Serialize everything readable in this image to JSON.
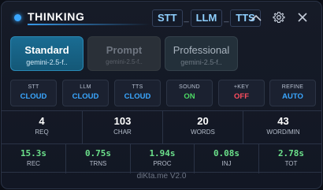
{
  "header": {
    "title": "THINKING",
    "pipeline": [
      "STT",
      "LLM",
      "TTS"
    ],
    "pipeline_separator": "_"
  },
  "modes": [
    {
      "name": "Standard",
      "model": "gemini-2.5-f..",
      "state": "active"
    },
    {
      "name": "Prompt",
      "model": "gemini-2.5-f..",
      "state": "disabled"
    },
    {
      "name": "Professional",
      "model": "gemini-2.5-f..",
      "state": "inactive"
    }
  ],
  "toggles": [
    {
      "label": "STT",
      "value": "CLOUD",
      "color": "#3aa7ff"
    },
    {
      "label": "LLM",
      "value": "CLOUD",
      "color": "#3aa7ff"
    },
    {
      "label": "TTS",
      "value": "CLOUD",
      "color": "#3aa7ff"
    },
    {
      "label": "SOUND",
      "value": "ON",
      "color": "#4cd964"
    },
    {
      "label": "+KEY",
      "value": "OFF",
      "color": "#ff4d5e"
    },
    {
      "label": "REFINE",
      "value": "AUTO",
      "color": "#3aa7ff"
    }
  ],
  "stats": [
    {
      "value": "4",
      "label": "REQ"
    },
    {
      "value": "103",
      "label": "CHAR"
    },
    {
      "value": "20",
      "label": "WORDS"
    },
    {
      "value": "43",
      "label": "WORD/MIN"
    }
  ],
  "timings": [
    {
      "value": "15.3s",
      "label": "REC"
    },
    {
      "value": "0.75s",
      "label": "TRNS"
    },
    {
      "value": "1.94s",
      "label": "PROC"
    },
    {
      "value": "0.08s",
      "label": "INJ"
    },
    {
      "value": "2.78s",
      "label": "TOT"
    }
  ],
  "footer": "diKta.me V2.0",
  "colors": {
    "accent": "#3aa7ff",
    "success": "#4cd964",
    "danger": "#ff4d5e",
    "timing": "#6be08a"
  }
}
